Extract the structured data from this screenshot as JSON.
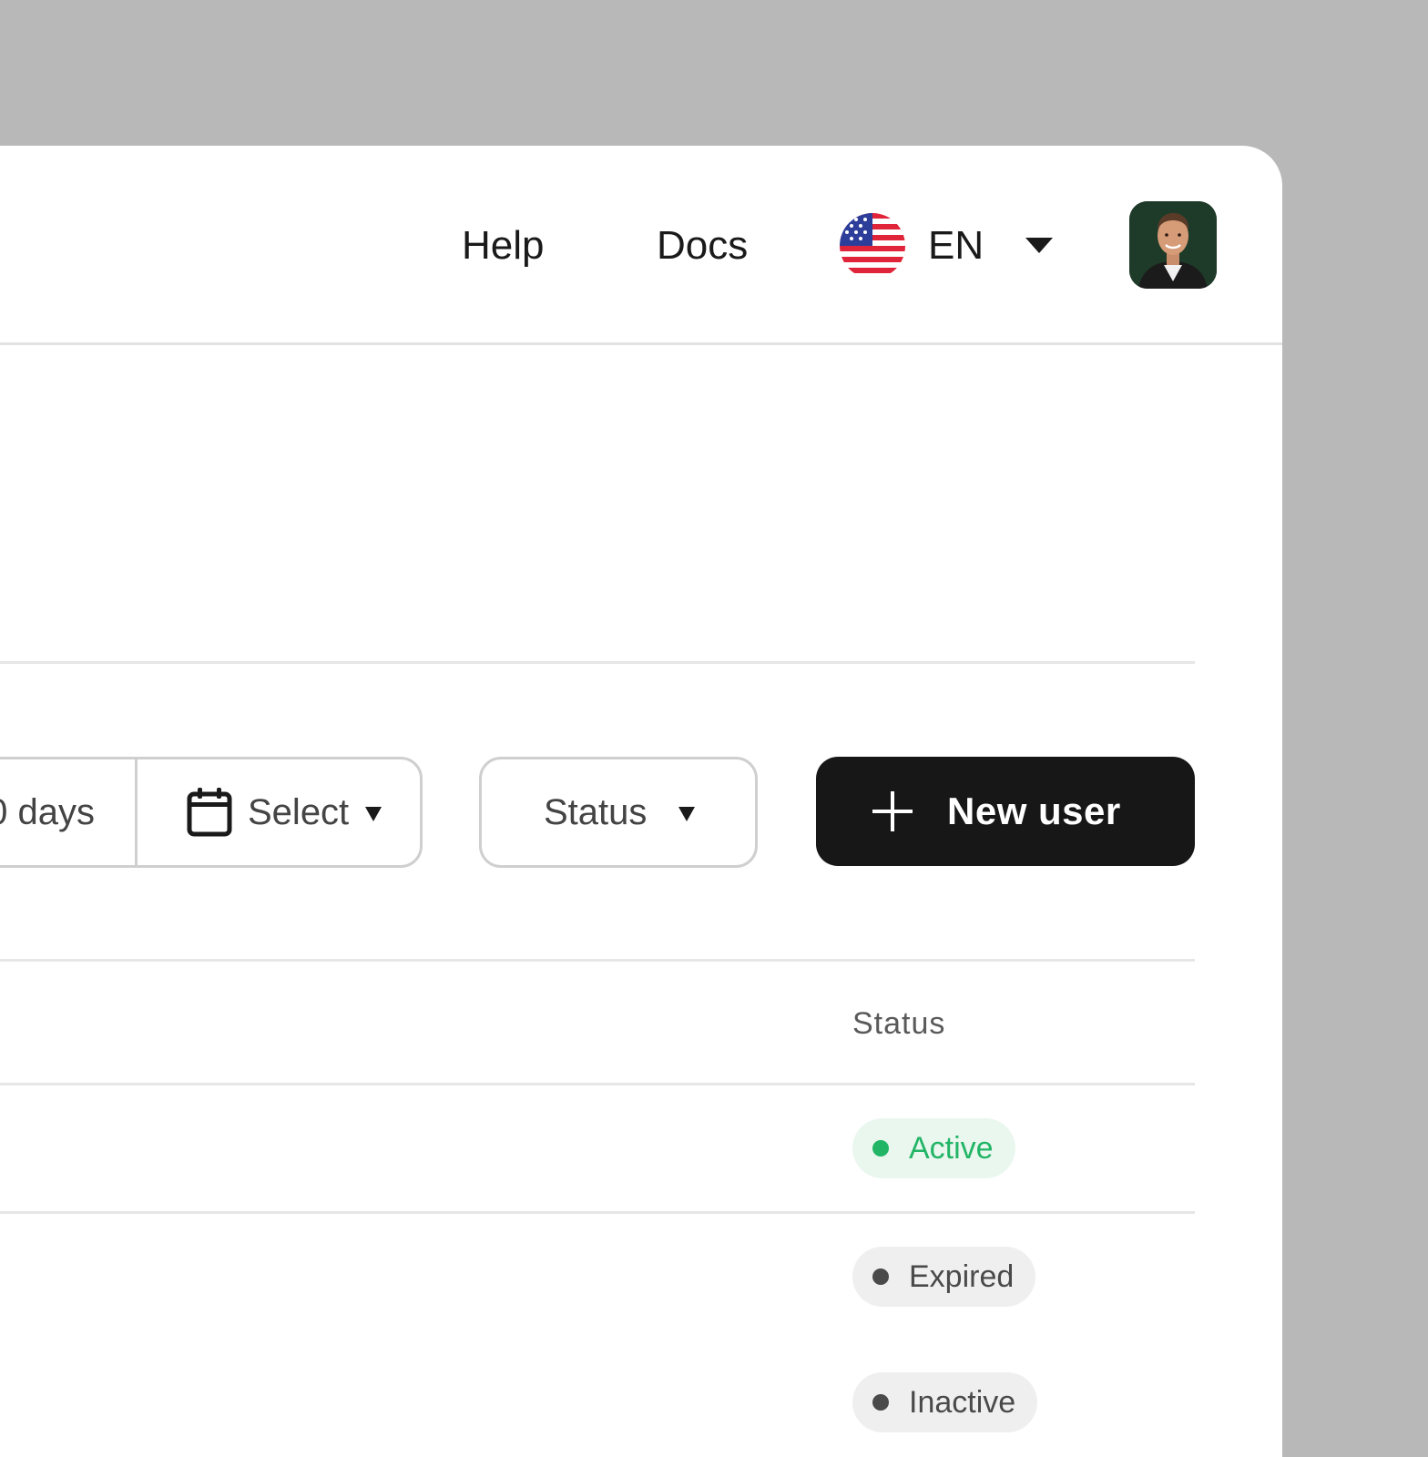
{
  "header": {
    "links": [
      {
        "label": "Help"
      },
      {
        "label": "Docs"
      }
    ],
    "language": {
      "code": "EN",
      "flag_icon": "us-flag-icon"
    },
    "avatar_icon": "user-avatar"
  },
  "toolbar": {
    "date_range_label": "0 days",
    "date_select_label": "Select",
    "status_filter_label": "Status",
    "new_user_label": "New user"
  },
  "table": {
    "columns": [
      "Status"
    ],
    "rows": [
      {
        "status": "Active",
        "status_color": "#22b566"
      },
      {
        "status": "Expired",
        "status_color": "#4a4a4a"
      },
      {
        "status": "Inactive",
        "status_color": "#4a4a4a"
      }
    ]
  },
  "colors": {
    "background": "#b8b8b8",
    "primary_button": "#171717",
    "active": "#22b566"
  }
}
